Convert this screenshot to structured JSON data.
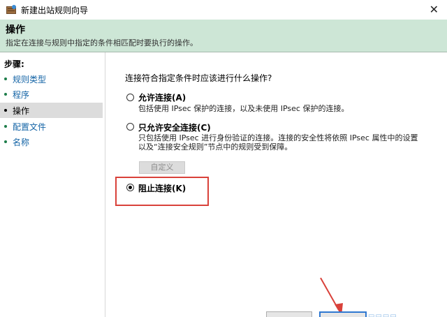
{
  "window": {
    "title": "新建出站规则向导"
  },
  "header": {
    "title": "操作",
    "subtitle": "指定在连接与规则中指定的条件相匹配时要执行的操作。"
  },
  "sidebar": {
    "steps_title": "步骤:",
    "items": [
      {
        "label": "规则类型"
      },
      {
        "label": "程序"
      },
      {
        "label": "操作"
      },
      {
        "label": "配置文件"
      },
      {
        "label": "名称"
      }
    ]
  },
  "main": {
    "question": "连接符合指定条件时应该进行什么操作?",
    "options": [
      {
        "label": "允许连接(A)",
        "desc": [
          "包括使用 IPsec 保护的连接，以及未使用 IPsec 保护的连接。"
        ]
      },
      {
        "label": "只允许安全连接(C)",
        "desc": [
          "只包括使用 IPsec 进行身份验证的连接。连接的安全性将依照 IPsec 属性中的设置",
          "以及“连接安全规则”节点中的规则受到保障。"
        ]
      },
      {
        "label": "阻止连接(K)",
        "desc": []
      }
    ],
    "custom_button": "自定义",
    "selected_option": "阻止连接(K)"
  },
  "colors": {
    "header_bg": "#cde6d6",
    "highlight_border": "#d9413a",
    "link_blue": "#1464a6",
    "primary_button_border": "#2f78d1"
  }
}
